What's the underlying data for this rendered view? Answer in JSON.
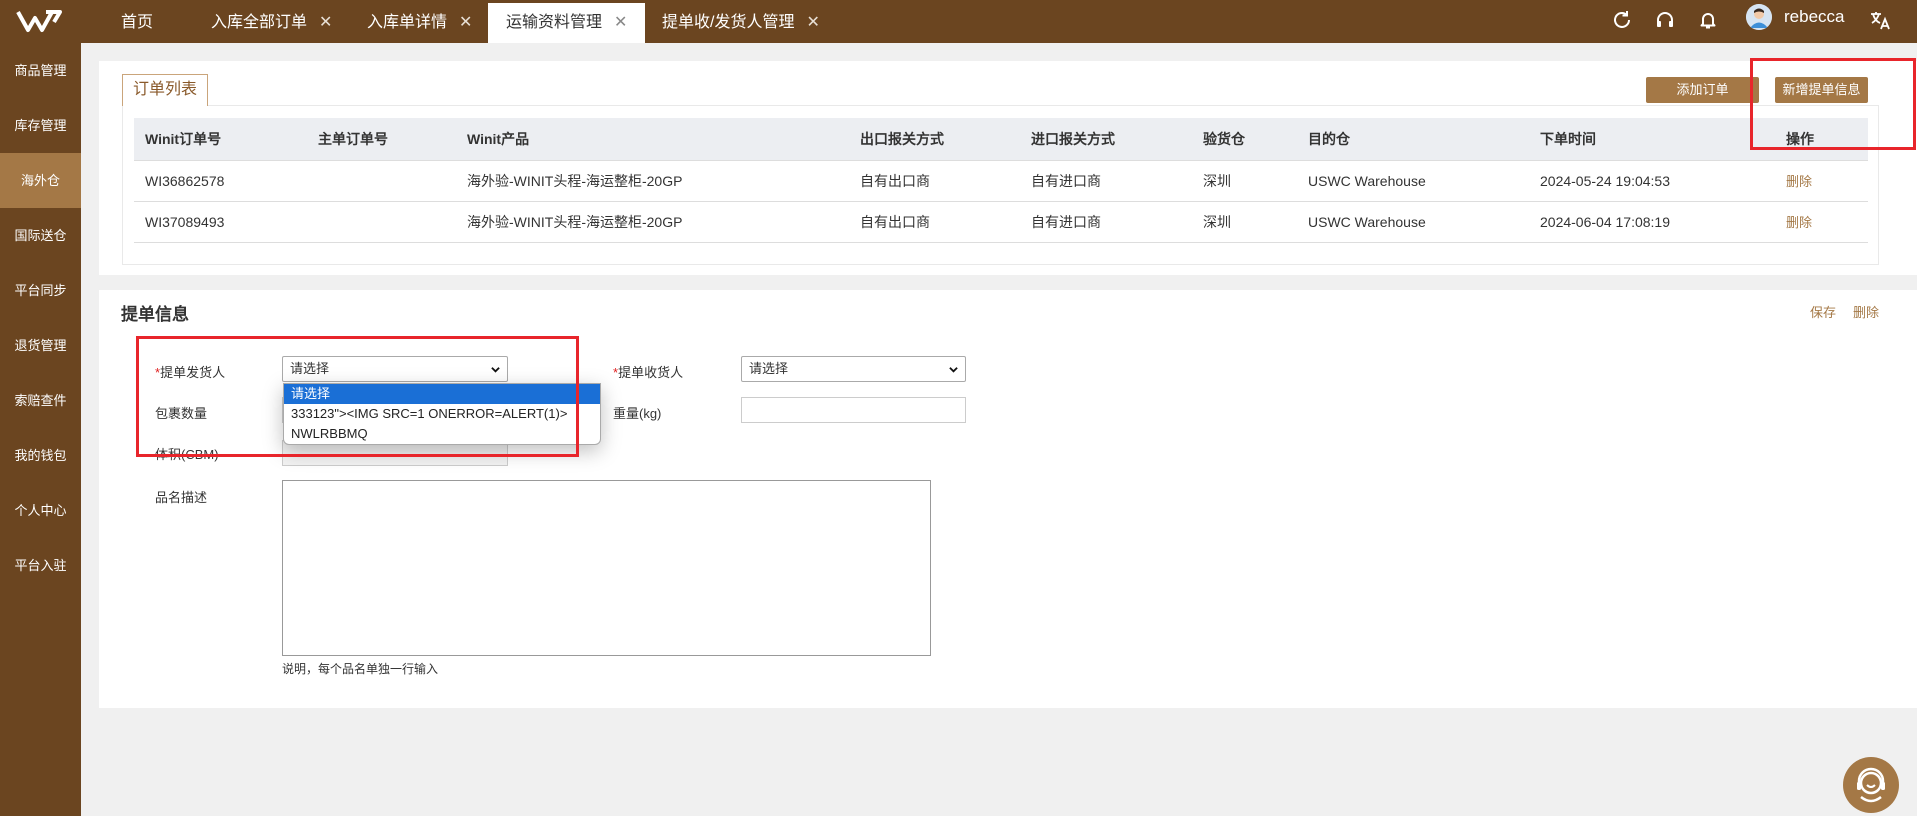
{
  "header": {
    "tabs": [
      {
        "label": "首页",
        "closable": false
      },
      {
        "label": "入库全部订单",
        "closable": true
      },
      {
        "label": "入库单详情",
        "closable": true
      },
      {
        "label": "运输资料管理",
        "closable": true
      },
      {
        "label": "提单收/发货人管理",
        "closable": true
      }
    ],
    "active_tab": "运输资料管理",
    "close_glyph": "✕",
    "username": "rebecca",
    "icons": [
      "refresh-icon",
      "headset-icon",
      "bell-icon",
      "avatar",
      "translate-icon"
    ]
  },
  "sidebar": {
    "items": [
      "商品管理",
      "库存管理",
      "海外仓",
      "国际送仓",
      "平台同步",
      "退货管理",
      "索赔查件",
      "我的钱包",
      "个人中心",
      "平台入驻"
    ],
    "active": "海外仓"
  },
  "order_list": {
    "title": "订单列表",
    "add_order_label": "添加订单",
    "add_bill_label": "新增提单信息",
    "columns": [
      "Winit订单号",
      "主单订单号",
      "Winit产品",
      "出口报关方式",
      "进口报关方式",
      "验货仓",
      "目的仓",
      "下单时间",
      "操作"
    ],
    "rows": [
      {
        "order_no": "WI36862578",
        "master_no": "",
        "product": "海外验-WINIT头程-海运整柜-20GP",
        "export_mode": "自有出口商",
        "import_mode": "自有进口商",
        "inspect_wh": "深圳",
        "dest_wh": "USWC Warehouse",
        "time": "2024-05-24 19:04:53",
        "action": "删除"
      },
      {
        "order_no": "WI37089493",
        "master_no": "",
        "product": "海外验-WINIT头程-海运整柜-20GP",
        "export_mode": "自有出口商",
        "import_mode": "自有进口商",
        "inspect_wh": "深圳",
        "dest_wh": "USWC Warehouse",
        "time": "2024-06-04 17:08:19",
        "action": "删除"
      }
    ]
  },
  "bill_info": {
    "title": "提单信息",
    "save_label": "保存",
    "delete_label": "删除",
    "required_mark": "*",
    "shipper_label": "提单发货人",
    "shipper_value": "请选择",
    "consignee_label": "提单收货人",
    "consignee_value": "请选择",
    "package_count_label": "包裹数量",
    "weight_label": "重量(kg)",
    "volume_label": "体积(CBM)",
    "description_label": "品名描述",
    "hint": "说明，每个品名单独一行输入",
    "dropdown_options": [
      "请选择",
      "333123\"><IMG SRC=1 ONERROR=ALERT(1)>",
      "NWLRBBMQ"
    ]
  },
  "colors": {
    "brand": "#6b4520",
    "accent": "#a47846",
    "highlight_box": "#e8252b"
  }
}
